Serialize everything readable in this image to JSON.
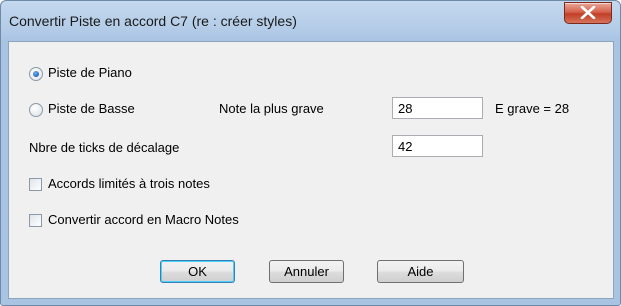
{
  "window": {
    "title": "Convertir Piste en accord C7 (re : créer styles)"
  },
  "options": {
    "piano_label": "Piste de Piano",
    "bass_label": "Piste de Basse",
    "lowest_note_label": "Note la plus grave",
    "lowest_note_value": "28",
    "lowest_note_hint": "E grave = 28",
    "offset_ticks_label": "Nbre de ticks de décalage",
    "offset_ticks_value": "42",
    "three_notes_label": "Accords limités à trois notes",
    "macro_notes_label": "Convertir accord en Macro Notes"
  },
  "buttons": {
    "ok": "OK",
    "cancel": "Annuler",
    "help": "Aide"
  }
}
